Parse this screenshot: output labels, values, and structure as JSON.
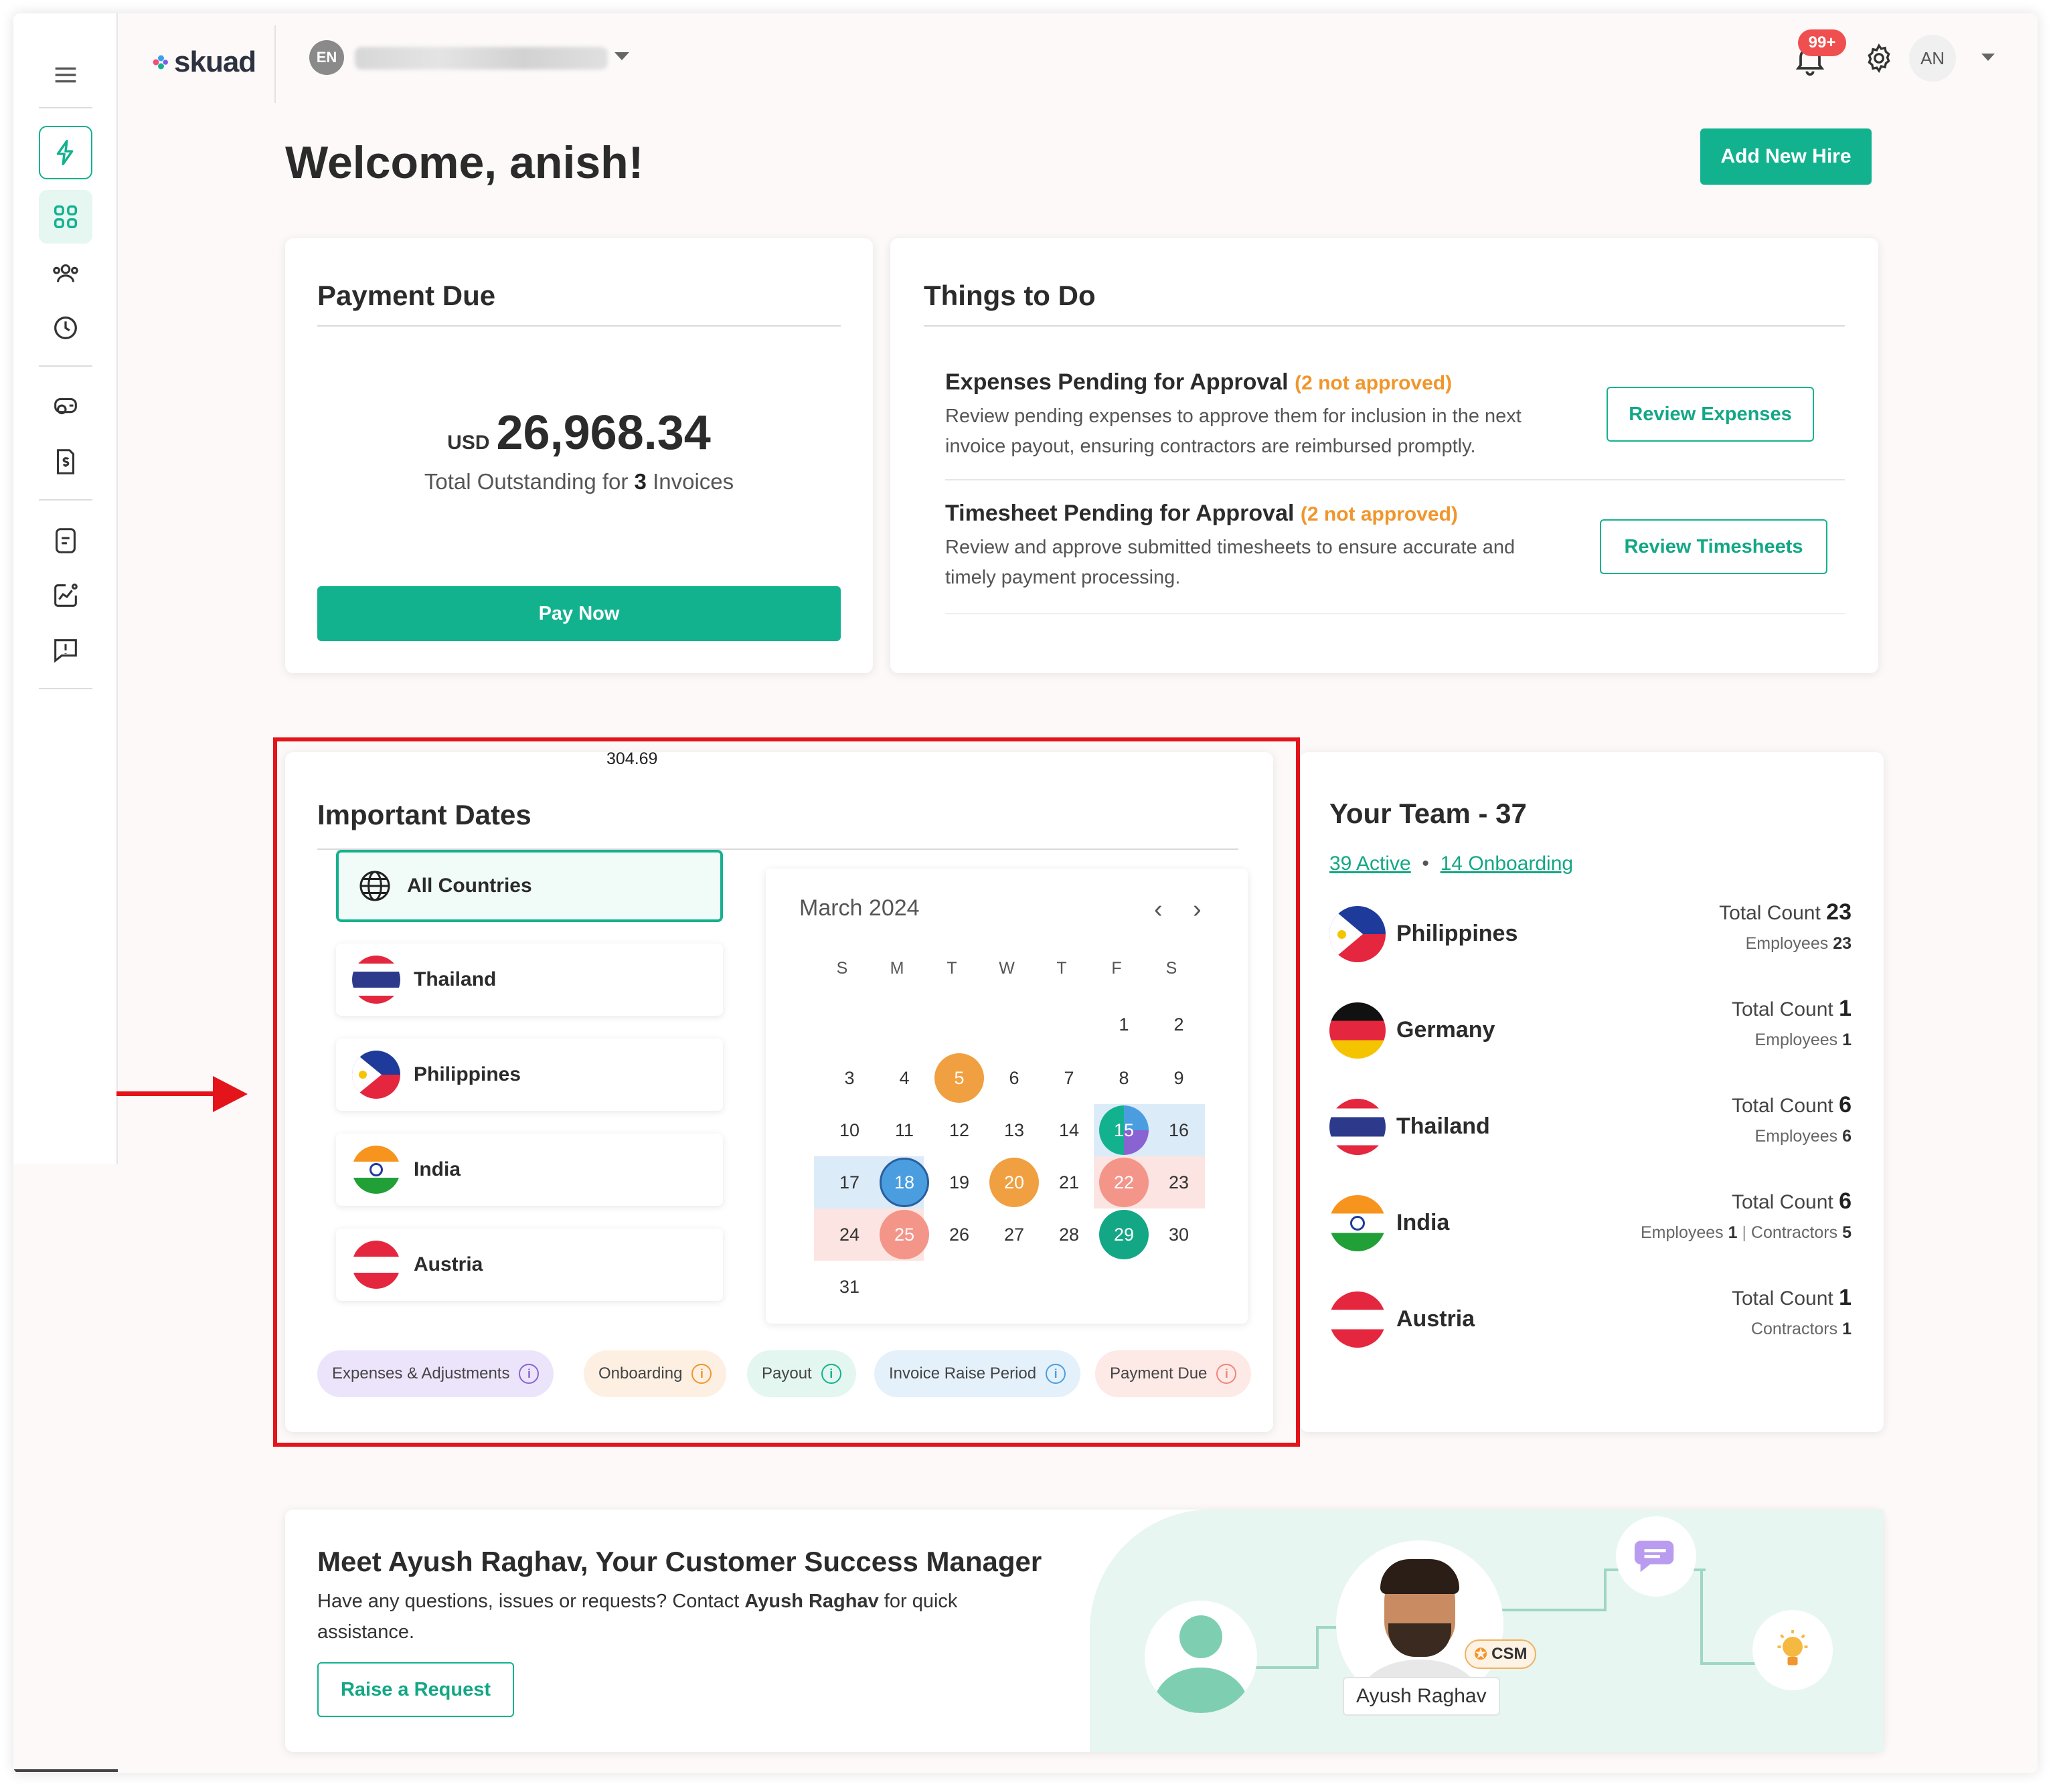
{
  "brand": {
    "name": "skuad",
    "accent": "#13b28f",
    "warn": "#f0962c",
    "annotation": "#e4141b"
  },
  "header": {
    "org_badge": "EN",
    "notifications_badge": "99+",
    "user_initials": "AN"
  },
  "sidebar": {
    "items": [
      "menu-icon",
      "bolt-icon",
      "dashboard-grid-icon",
      "team-icon",
      "clock-icon",
      "payroll-icon",
      "dollar-document-icon",
      "document-icon",
      "analytics-icon",
      "feedback-icon"
    ]
  },
  "welcome": {
    "text": "Welcome, anish!",
    "add_hire_label": "Add New Hire"
  },
  "payment_due": {
    "title": "Payment Due",
    "currency": "USD",
    "amount": "26,968.34",
    "subtitle_prefix": "Total Outstanding for",
    "invoice_count": "3",
    "subtitle_suffix": "Invoices",
    "pay_label": "Pay Now"
  },
  "things_to_do": {
    "title": "Things to Do",
    "items": [
      {
        "title": "Expenses Pending for Approval",
        "status": "(2 not approved)",
        "desc": "Review pending expenses to approve them for inclusion in the next invoice payout, ensuring contractors are reimbursed promptly.",
        "action": "Review Expenses"
      },
      {
        "title": "Timesheet Pending for Approval",
        "status": "(2 not approved)",
        "desc": "Review and approve submitted timesheets to ensure accurate and timely payment processing.",
        "action": "Review Timesheets"
      }
    ]
  },
  "important_dates": {
    "measure_label": "304.69",
    "title": "Important Dates",
    "countries": [
      "All Countries",
      "Thailand",
      "Philippines",
      "India",
      "Austria"
    ],
    "calendar": {
      "month": "March 2024",
      "prev": "‹",
      "next": "›",
      "dow": [
        "S",
        "M",
        "T",
        "W",
        "T",
        "F",
        "S"
      ],
      "days": [
        "1",
        "2",
        "3",
        "4",
        "5",
        "6",
        "7",
        "8",
        "9",
        "10",
        "11",
        "12",
        "13",
        "14",
        "15",
        "16",
        "17",
        "18",
        "19",
        "20",
        "21",
        "22",
        "23",
        "24",
        "25",
        "26",
        "27",
        "28",
        "29",
        "30",
        "31"
      ]
    },
    "legend": [
      {
        "label": "Expenses & Adjustments",
        "bg": "#ece4fb",
        "color": "#8a63d2"
      },
      {
        "label": "Onboarding",
        "bg": "#fdf0e3",
        "color": "#f0962c"
      },
      {
        "label": "Payout",
        "bg": "#e3f6ef",
        "color": "#13b28f"
      },
      {
        "label": "Invoice Raise Period",
        "bg": "#e4f1fb",
        "color": "#4a9ee0"
      },
      {
        "label": "Payment Due",
        "bg": "#fde9e6",
        "color": "#f0867a"
      }
    ]
  },
  "team": {
    "title": "Your Team - 37",
    "active": "39 Active",
    "onboarding": "14 Onboarding",
    "separator": "•",
    "rows": [
      {
        "country": "Philippines",
        "count_label": "Total Count",
        "count": "23",
        "detail": [
          {
            "k": "Employees",
            "v": "23"
          }
        ]
      },
      {
        "country": "Germany",
        "count_label": "Total Count",
        "count": "1",
        "detail": [
          {
            "k": "Employees",
            "v": "1"
          }
        ]
      },
      {
        "country": "Thailand",
        "count_label": "Total Count",
        "count": "6",
        "detail": [
          {
            "k": "Employees",
            "v": "6"
          }
        ]
      },
      {
        "country": "India",
        "count_label": "Total Count",
        "count": "6",
        "detail": [
          {
            "k": "Employees",
            "v": "1"
          },
          {
            "k": "Contractors",
            "v": "5"
          }
        ]
      },
      {
        "country": "Austria",
        "count_label": "Total Count",
        "count": "1",
        "detail": [
          {
            "k": "Contractors",
            "v": "1"
          }
        ]
      }
    ]
  },
  "csm": {
    "title": "Meet Ayush Raghav, Your Customer Success Manager",
    "text_prefix": "Have any questions, issues or requests? Contact",
    "name": "Ayush Raghav",
    "text_suffix": "for quick assistance.",
    "request_label": "Raise a Request",
    "badge": "CSM",
    "name_tag": "Ayush Raghav"
  }
}
